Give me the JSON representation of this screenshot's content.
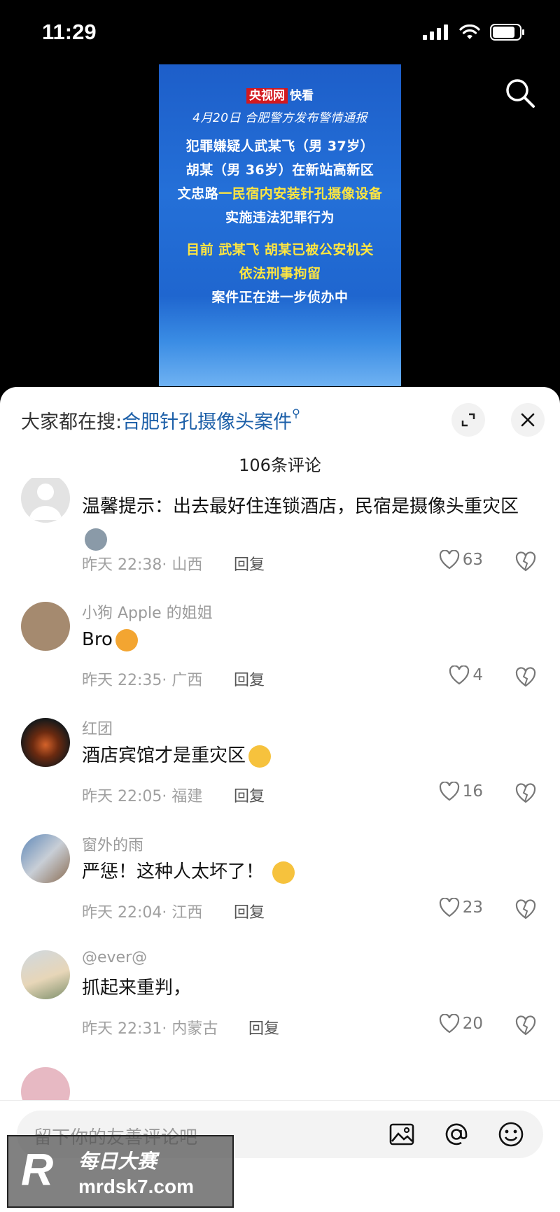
{
  "status_bar": {
    "time": "11:29"
  },
  "video": {
    "logo_brand": "央视网",
    "logo_text": "快看",
    "subtitle": "4月20日 合肥警方发布警情通报",
    "line1": "犯罪嫌疑人武某飞（男 37岁）",
    "line2": "胡某（男 36岁）在新站高新区",
    "line3_white": "文忠路",
    "line3_yellow": "一民宿内安装针孔摄像设备",
    "line4": "实施违法犯罪行为",
    "line5": "目前 武某飞 胡某已被公安机关",
    "line6": "依法刑事拘留",
    "line7": "案件正在进一步侦办中"
  },
  "sheet": {
    "hot_search_prefix": "大家都在搜:",
    "hot_search_link": "合肥针孔摄像头案件",
    "comment_count": "106条评论"
  },
  "comments": [
    {
      "name": "",
      "text": "温馨提示：出去最好住连锁酒店，民宿是摄像头重灾区",
      "emoji": "husky",
      "time": "昨天 22:38",
      "region": "· 山西",
      "reply": "回复",
      "likes": "63"
    },
    {
      "name": "小狗 Apple 的姐姐",
      "text": "Bro",
      "emoji": "thumbs-up",
      "time": "昨天 22:35",
      "region": "· 广西",
      "reply": "回复",
      "likes": "4"
    },
    {
      "name": "红团",
      "text": "酒店宾馆才是重灾区",
      "emoji": "laugh",
      "time": "昨天 22:05",
      "region": "· 福建",
      "reply": "回复",
      "likes": "16"
    },
    {
      "name": "窗外的雨",
      "text": "严惩！这种人太坏了！",
      "emoji": "sunglasses",
      "time": "昨天 22:04",
      "region": "· 江西",
      "reply": "回复",
      "likes": "23"
    },
    {
      "name": "@ever@",
      "text": "抓起来重判，",
      "emoji": "",
      "time": "昨天 22:31",
      "region": "· 内蒙古",
      "reply": "回复",
      "likes": "20"
    }
  ],
  "input": {
    "placeholder": "留下你的友善评论吧"
  },
  "watermark": {
    "logo": "R",
    "name": "每日大赛",
    "url": "mrdsk7.com"
  },
  "colors": {
    "link": "#1c5fa8",
    "video_blue": "#1f66cf",
    "highlight_yellow": "#ffe640",
    "brand_red": "#d3191f"
  }
}
